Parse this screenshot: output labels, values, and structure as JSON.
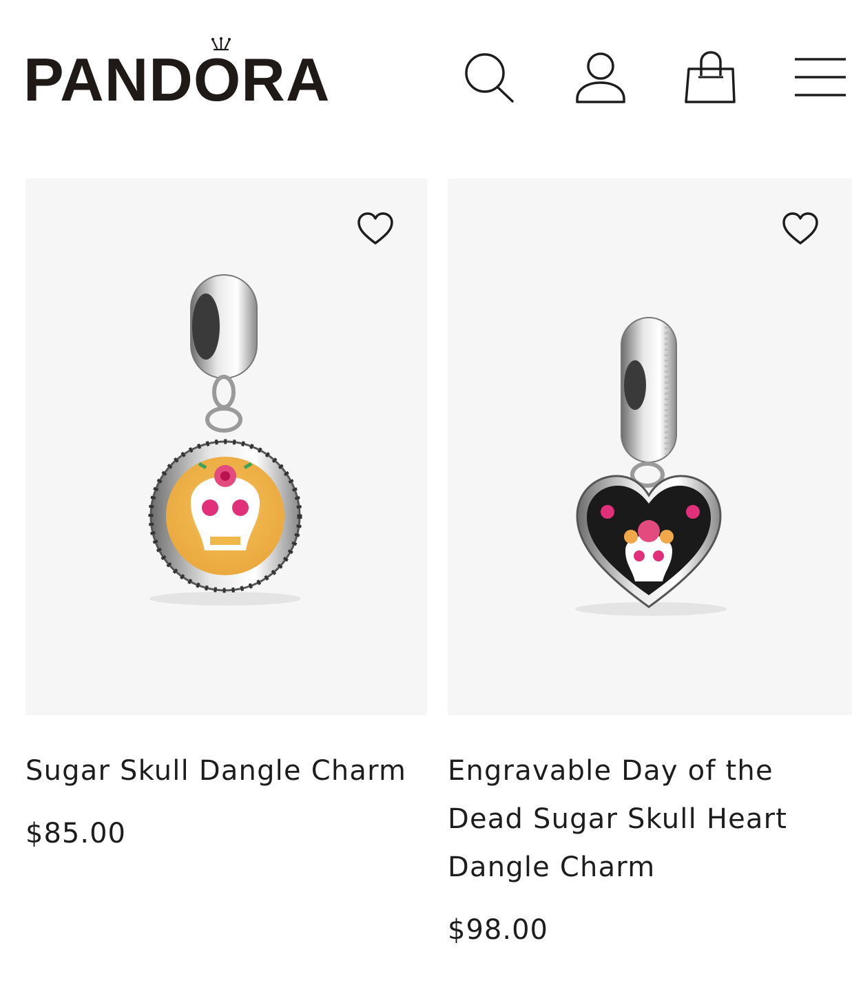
{
  "header": {
    "brand": "PANDORA",
    "icons": [
      "search-icon",
      "account-icon",
      "bag-icon",
      "menu-icon"
    ]
  },
  "products": [
    {
      "title": "Sugar Skull Dangle Charm",
      "price": "$85.00",
      "image_desc_icon": "sugar-skull-round-charm",
      "favorite": false
    },
    {
      "title": "Engravable Day of the Dead Sugar Skull Heart Dangle Charm",
      "price": "$98.00",
      "image_desc_icon": "sugar-skull-heart-charm",
      "favorite": false
    }
  ],
  "colors": {
    "text": "#1d1d1d",
    "card_bg": "#f6f6f6",
    "accent_pink": "#e0307a",
    "accent_yellow": "#f0b84a"
  }
}
